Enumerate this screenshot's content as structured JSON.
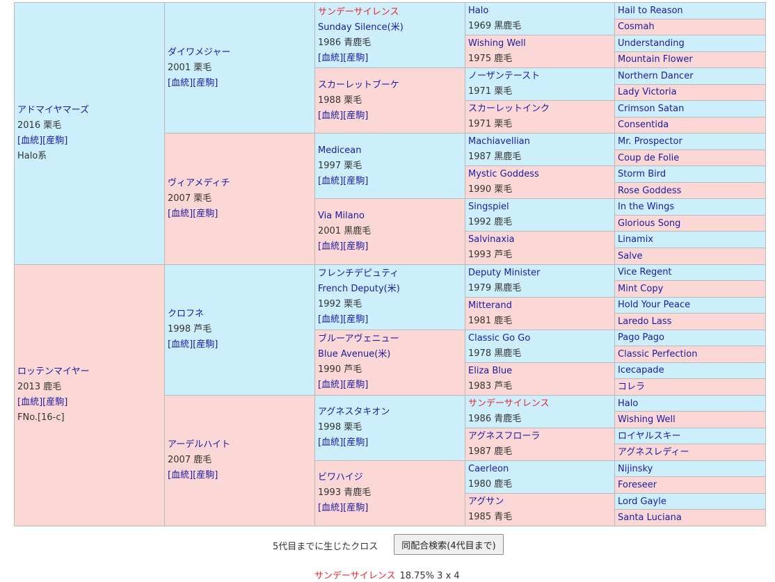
{
  "pedigree": {
    "sire": {
      "name": "アドマイヤマーズ",
      "year_color": "2016 栗毛",
      "links": "[血統][産駒]",
      "extra": "Halo系",
      "sex": "male"
    },
    "dam": {
      "name": "ロッテンマイヤー",
      "year_color": "2013 鹿毛",
      "links": "[血統][産駒]",
      "extra": "FNo.[16-c]",
      "sex": "female"
    },
    "gen2": [
      {
        "name": "ダイワメジャー",
        "year_color": "2001 栗毛",
        "links": "[血統][産駒]",
        "sex": "male"
      },
      {
        "name": "ヴィアメディチ",
        "year_color": "2007 栗毛",
        "links": "[血統][産駒]",
        "sex": "female"
      },
      {
        "name": "クロフネ",
        "year_color": "1998 芦毛",
        "links": "[血統][産駒]",
        "sex": "male"
      },
      {
        "name": "アーデルハイト",
        "year_color": "2007 鹿毛",
        "links": "[血統][産駒]",
        "sex": "female"
      }
    ],
    "gen3": [
      {
        "name": "サンデーサイレンス",
        "sub": "Sunday Silence(米)",
        "year_color": "1986 青鹿毛",
        "links": "[血統][産駒]",
        "sex": "male",
        "red": true
      },
      {
        "name": "スカーレットブーケ",
        "sub": "",
        "year_color": "1988 栗毛",
        "links": "[血統][産駒]",
        "sex": "female",
        "red": false
      },
      {
        "name": "Medicean",
        "sub": "",
        "year_color": "1997 栗毛",
        "links": "[血統][産駒]",
        "sex": "male",
        "red": false
      },
      {
        "name": "Via Milano",
        "sub": "",
        "year_color": "2001 黒鹿毛",
        "links": "[血統][産駒]",
        "sex": "female",
        "red": false
      },
      {
        "name": "フレンチデピュティ",
        "sub": "French Deputy(米)",
        "year_color": "1992 栗毛",
        "links": "[血統][産駒]",
        "sex": "male",
        "red": false
      },
      {
        "name": "ブルーアヴェニュー",
        "sub": "Blue Avenue(米)",
        "year_color": "1990 芦毛",
        "links": "[血統][産駒]",
        "sex": "female",
        "red": false
      },
      {
        "name": "アグネスタキオン",
        "sub": "",
        "year_color": "1998 栗毛",
        "links": "[血統][産駒]",
        "sex": "male",
        "red": false
      },
      {
        "name": "ビワハイジ",
        "sub": "",
        "year_color": "1993 青鹿毛",
        "links": "[血統][産駒]",
        "sex": "female",
        "red": false
      }
    ],
    "gen4": [
      {
        "name": "Halo",
        "year_color": "1969 黒鹿毛",
        "sex": "male",
        "red": false
      },
      {
        "name": "Wishing Well",
        "year_color": "1975 鹿毛",
        "sex": "female",
        "red": false
      },
      {
        "name": "ノーザンテースト",
        "year_color": "1971 栗毛",
        "sex": "male",
        "red": false
      },
      {
        "name": "スカーレットインク",
        "year_color": "1971 栗毛",
        "sex": "female",
        "red": false
      },
      {
        "name": "Machiavellian",
        "year_color": "1987 黒鹿毛",
        "sex": "male",
        "red": false
      },
      {
        "name": "Mystic Goddess",
        "year_color": "1990 栗毛",
        "sex": "female",
        "red": false
      },
      {
        "name": "Singspiel",
        "year_color": "1992 鹿毛",
        "sex": "male",
        "red": false
      },
      {
        "name": "Salvinaxia",
        "year_color": "1993 芦毛",
        "sex": "female",
        "red": false
      },
      {
        "name": "Deputy Minister",
        "year_color": "1979 黒鹿毛",
        "sex": "male",
        "red": false
      },
      {
        "name": "Mitterand",
        "year_color": "1981 鹿毛",
        "sex": "female",
        "red": false
      },
      {
        "name": "Classic Go Go",
        "year_color": "1978 黒鹿毛",
        "sex": "male",
        "red": false
      },
      {
        "name": "Eliza Blue",
        "year_color": "1983 芦毛",
        "sex": "female",
        "red": false
      },
      {
        "name": "サンデーサイレンス",
        "year_color": "1986 青鹿毛",
        "sex": "male",
        "red": true
      },
      {
        "name": "アグネスフローラ",
        "year_color": "1987 鹿毛",
        "sex": "female",
        "red": false
      },
      {
        "name": "Caerleon",
        "year_color": "1980 鹿毛",
        "sex": "male",
        "red": false
      },
      {
        "name": "アグサン",
        "year_color": "1985 青毛",
        "sex": "female",
        "red": false
      }
    ],
    "gen5": [
      "Hail to Reason",
      "Cosmah",
      "Understanding",
      "Mountain Flower",
      "Northern Dancer",
      "Lady Victoria",
      "Crimson Satan",
      "Consentida",
      "Mr. Prospector",
      "Coup de Folie",
      "Storm Bird",
      "Rose Goddess",
      "In the Wings",
      "Glorious Song",
      "Linamix",
      "Salve",
      "Vice Regent",
      "Mint Copy",
      "Hold Your Peace",
      "Laredo Lass",
      "Pago Pago",
      "Classic Perfection",
      "Icecapade",
      "コレラ",
      "Halo",
      "Wishing Well",
      "ロイヤルスキー",
      "アグネスレディー",
      "Nijinsky",
      "Foreseer",
      "Lord Gayle",
      "Santa Luciana"
    ]
  },
  "footer": {
    "cross_label": "5代目までに生じたクロス",
    "search_button": "同配合検索(4代目まで)",
    "cross_name": "サンデーサイレンス",
    "cross_detail": "18.75%  3 x 4"
  },
  "colors": {
    "male_bg": "#cdeefb",
    "female_bg": "#fbd8d5",
    "link": "#1a1aa6",
    "highlight": "#e8252f"
  }
}
